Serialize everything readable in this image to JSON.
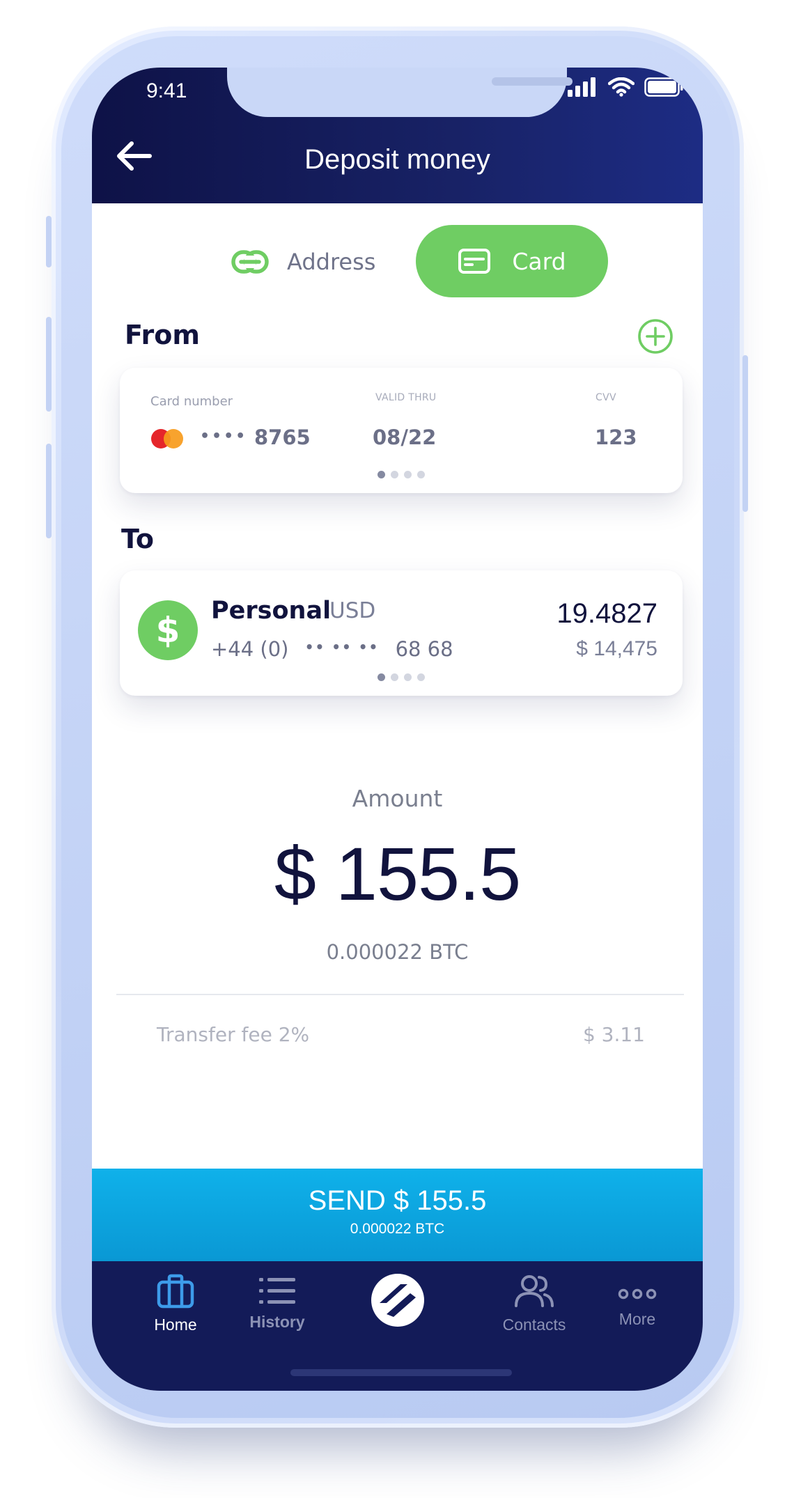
{
  "status_bar": {
    "time": "9:41"
  },
  "header": {
    "title": "Deposit money",
    "back_icon": "arrow-left-icon"
  },
  "method_toggle": {
    "options": [
      {
        "label": "Address",
        "icon": "link-icon",
        "selected": false
      },
      {
        "label": "Card",
        "icon": "credit-card-icon",
        "selected": true
      }
    ]
  },
  "from": {
    "label": "From",
    "add_icon": "plus-circle-icon",
    "card": {
      "number_label": "Card number",
      "masked_dots": "••••",
      "last4": "8765",
      "valid_label": "VALID THRU",
      "valid_value": "08/22",
      "cvv_label": "CVV",
      "cvv_value": "123",
      "page_index": 0,
      "page_count": 4
    }
  },
  "to": {
    "label": "To",
    "account": {
      "name": "Personal",
      "currency": "USD",
      "phone_prefix": "+44 (0)",
      "masked_dots": "•• •• ••",
      "phone_suffix": "68 68",
      "balance": "19.4827",
      "fiat_balance": "$ 14,475",
      "page_index": 0,
      "page_count": 4
    }
  },
  "amount": {
    "label": "Amount",
    "value": "$ 155.5",
    "btc": "0.000022 BTC"
  },
  "fee": {
    "label": "Transfer fee 2%",
    "value": "$ 3.11"
  },
  "send": {
    "label": "SEND $ 155.5",
    "sub": "0.000022 BTC"
  },
  "tabbar": {
    "items": [
      {
        "label": "Home",
        "icon": "briefcase-icon",
        "active": true
      },
      {
        "label": "History",
        "icon": "list-icon",
        "active": false
      },
      {
        "label": "",
        "icon": "brand-logo-icon",
        "active": false
      },
      {
        "label": "Contacts",
        "icon": "contacts-icon",
        "active": false
      },
      {
        "label": "More",
        "icon": "more-dots-icon",
        "active": false
      }
    ]
  },
  "colors": {
    "header_bg": "#131b58",
    "accent_green": "#6fcd63",
    "send_blue": "#0fb1ea",
    "text_dark": "#11133d",
    "tab_active_icon": "#3d9be9"
  }
}
